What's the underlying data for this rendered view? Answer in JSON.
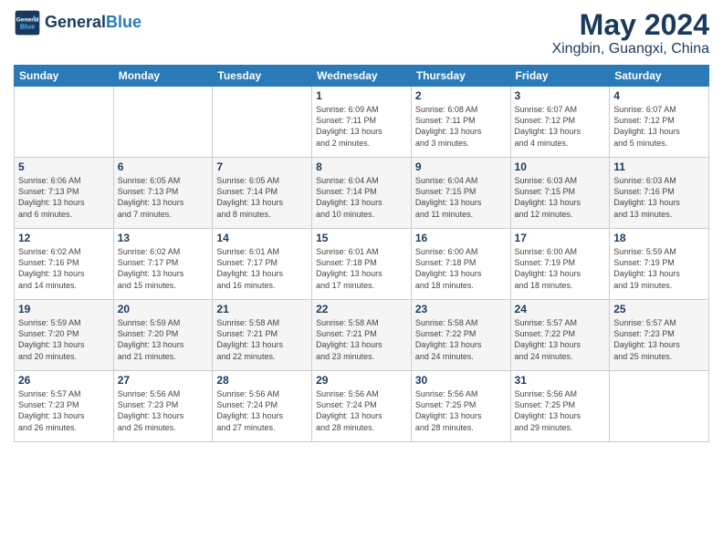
{
  "header": {
    "logo_line1": "General",
    "logo_line2": "Blue",
    "month": "May 2024",
    "location": "Xingbin, Guangxi, China"
  },
  "weekdays": [
    "Sunday",
    "Monday",
    "Tuesday",
    "Wednesday",
    "Thursday",
    "Friday",
    "Saturday"
  ],
  "weeks": [
    [
      {
        "day": "",
        "info": ""
      },
      {
        "day": "",
        "info": ""
      },
      {
        "day": "",
        "info": ""
      },
      {
        "day": "1",
        "info": "Sunrise: 6:09 AM\nSunset: 7:11 PM\nDaylight: 13 hours\nand 2 minutes."
      },
      {
        "day": "2",
        "info": "Sunrise: 6:08 AM\nSunset: 7:11 PM\nDaylight: 13 hours\nand 3 minutes."
      },
      {
        "day": "3",
        "info": "Sunrise: 6:07 AM\nSunset: 7:12 PM\nDaylight: 13 hours\nand 4 minutes."
      },
      {
        "day": "4",
        "info": "Sunrise: 6:07 AM\nSunset: 7:12 PM\nDaylight: 13 hours\nand 5 minutes."
      }
    ],
    [
      {
        "day": "5",
        "info": "Sunrise: 6:06 AM\nSunset: 7:13 PM\nDaylight: 13 hours\nand 6 minutes."
      },
      {
        "day": "6",
        "info": "Sunrise: 6:05 AM\nSunset: 7:13 PM\nDaylight: 13 hours\nand 7 minutes."
      },
      {
        "day": "7",
        "info": "Sunrise: 6:05 AM\nSunset: 7:14 PM\nDaylight: 13 hours\nand 8 minutes."
      },
      {
        "day": "8",
        "info": "Sunrise: 6:04 AM\nSunset: 7:14 PM\nDaylight: 13 hours\nand 10 minutes."
      },
      {
        "day": "9",
        "info": "Sunrise: 6:04 AM\nSunset: 7:15 PM\nDaylight: 13 hours\nand 11 minutes."
      },
      {
        "day": "10",
        "info": "Sunrise: 6:03 AM\nSunset: 7:15 PM\nDaylight: 13 hours\nand 12 minutes."
      },
      {
        "day": "11",
        "info": "Sunrise: 6:03 AM\nSunset: 7:16 PM\nDaylight: 13 hours\nand 13 minutes."
      }
    ],
    [
      {
        "day": "12",
        "info": "Sunrise: 6:02 AM\nSunset: 7:16 PM\nDaylight: 13 hours\nand 14 minutes."
      },
      {
        "day": "13",
        "info": "Sunrise: 6:02 AM\nSunset: 7:17 PM\nDaylight: 13 hours\nand 15 minutes."
      },
      {
        "day": "14",
        "info": "Sunrise: 6:01 AM\nSunset: 7:17 PM\nDaylight: 13 hours\nand 16 minutes."
      },
      {
        "day": "15",
        "info": "Sunrise: 6:01 AM\nSunset: 7:18 PM\nDaylight: 13 hours\nand 17 minutes."
      },
      {
        "day": "16",
        "info": "Sunrise: 6:00 AM\nSunset: 7:18 PM\nDaylight: 13 hours\nand 18 minutes."
      },
      {
        "day": "17",
        "info": "Sunrise: 6:00 AM\nSunset: 7:19 PM\nDaylight: 13 hours\nand 18 minutes."
      },
      {
        "day": "18",
        "info": "Sunrise: 5:59 AM\nSunset: 7:19 PM\nDaylight: 13 hours\nand 19 minutes."
      }
    ],
    [
      {
        "day": "19",
        "info": "Sunrise: 5:59 AM\nSunset: 7:20 PM\nDaylight: 13 hours\nand 20 minutes."
      },
      {
        "day": "20",
        "info": "Sunrise: 5:59 AM\nSunset: 7:20 PM\nDaylight: 13 hours\nand 21 minutes."
      },
      {
        "day": "21",
        "info": "Sunrise: 5:58 AM\nSunset: 7:21 PM\nDaylight: 13 hours\nand 22 minutes."
      },
      {
        "day": "22",
        "info": "Sunrise: 5:58 AM\nSunset: 7:21 PM\nDaylight: 13 hours\nand 23 minutes."
      },
      {
        "day": "23",
        "info": "Sunrise: 5:58 AM\nSunset: 7:22 PM\nDaylight: 13 hours\nand 24 minutes."
      },
      {
        "day": "24",
        "info": "Sunrise: 5:57 AM\nSunset: 7:22 PM\nDaylight: 13 hours\nand 24 minutes."
      },
      {
        "day": "25",
        "info": "Sunrise: 5:57 AM\nSunset: 7:23 PM\nDaylight: 13 hours\nand 25 minutes."
      }
    ],
    [
      {
        "day": "26",
        "info": "Sunrise: 5:57 AM\nSunset: 7:23 PM\nDaylight: 13 hours\nand 26 minutes."
      },
      {
        "day": "27",
        "info": "Sunrise: 5:56 AM\nSunset: 7:23 PM\nDaylight: 13 hours\nand 26 minutes."
      },
      {
        "day": "28",
        "info": "Sunrise: 5:56 AM\nSunset: 7:24 PM\nDaylight: 13 hours\nand 27 minutes."
      },
      {
        "day": "29",
        "info": "Sunrise: 5:56 AM\nSunset: 7:24 PM\nDaylight: 13 hours\nand 28 minutes."
      },
      {
        "day": "30",
        "info": "Sunrise: 5:56 AM\nSunset: 7:25 PM\nDaylight: 13 hours\nand 28 minutes."
      },
      {
        "day": "31",
        "info": "Sunrise: 5:56 AM\nSunset: 7:25 PM\nDaylight: 13 hours\nand 29 minutes."
      },
      {
        "day": "",
        "info": ""
      }
    ]
  ]
}
